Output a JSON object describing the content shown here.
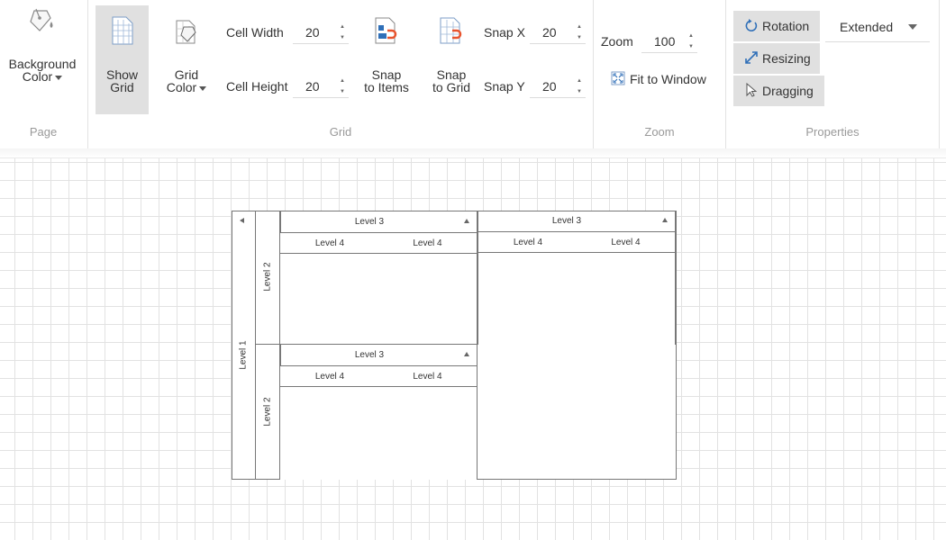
{
  "ribbon": {
    "page": {
      "group_label": "Page",
      "background_color": {
        "line1": "Background",
        "line2": "Color"
      }
    },
    "grid": {
      "group_label": "Grid",
      "show_grid": {
        "line1": "Show",
        "line2": "Grid",
        "active": true
      },
      "grid_color": {
        "line1": "Grid",
        "line2": "Color"
      },
      "cell_width": {
        "label": "Cell Width",
        "value": "20"
      },
      "cell_height": {
        "label": "Cell Height",
        "value": "20"
      },
      "snap_to_items": {
        "line1": "Snap",
        "line2": "to Items"
      },
      "snap_to_grid": {
        "line1": "Snap",
        "line2": "to Grid"
      },
      "snap_x": {
        "label": "Snap X",
        "value": "20"
      },
      "snap_y": {
        "label": "Snap Y",
        "value": "20"
      }
    },
    "zoom": {
      "group_label": "Zoom",
      "zoom_label": "Zoom",
      "zoom_value": "100",
      "fit_to_window": "Fit to Window"
    },
    "properties": {
      "group_label": "Properties",
      "rotation": "Rotation",
      "resizing": "Resizing",
      "dragging": "Dragging",
      "mode_dropdown": "Extended"
    }
  },
  "diagram": {
    "level1": "Level 1",
    "level2_top": "Level 2",
    "level2_bottom": "Level 2",
    "top_left": {
      "header": "Level 3",
      "col1": "Level 4",
      "col2": "Level 4"
    },
    "top_right": {
      "header": "Level 3",
      "col1": "Level 4",
      "col2": "Level 4"
    },
    "bottom_left": {
      "header": "Level 3",
      "col1": "Level 4",
      "col2": "Level 4"
    }
  },
  "colors": {
    "active_button_bg": "#e0e0e0",
    "grid_line": "#e2e2e2",
    "accent_icon": "#2f6fb8",
    "snap_icon": "#e8542e"
  }
}
